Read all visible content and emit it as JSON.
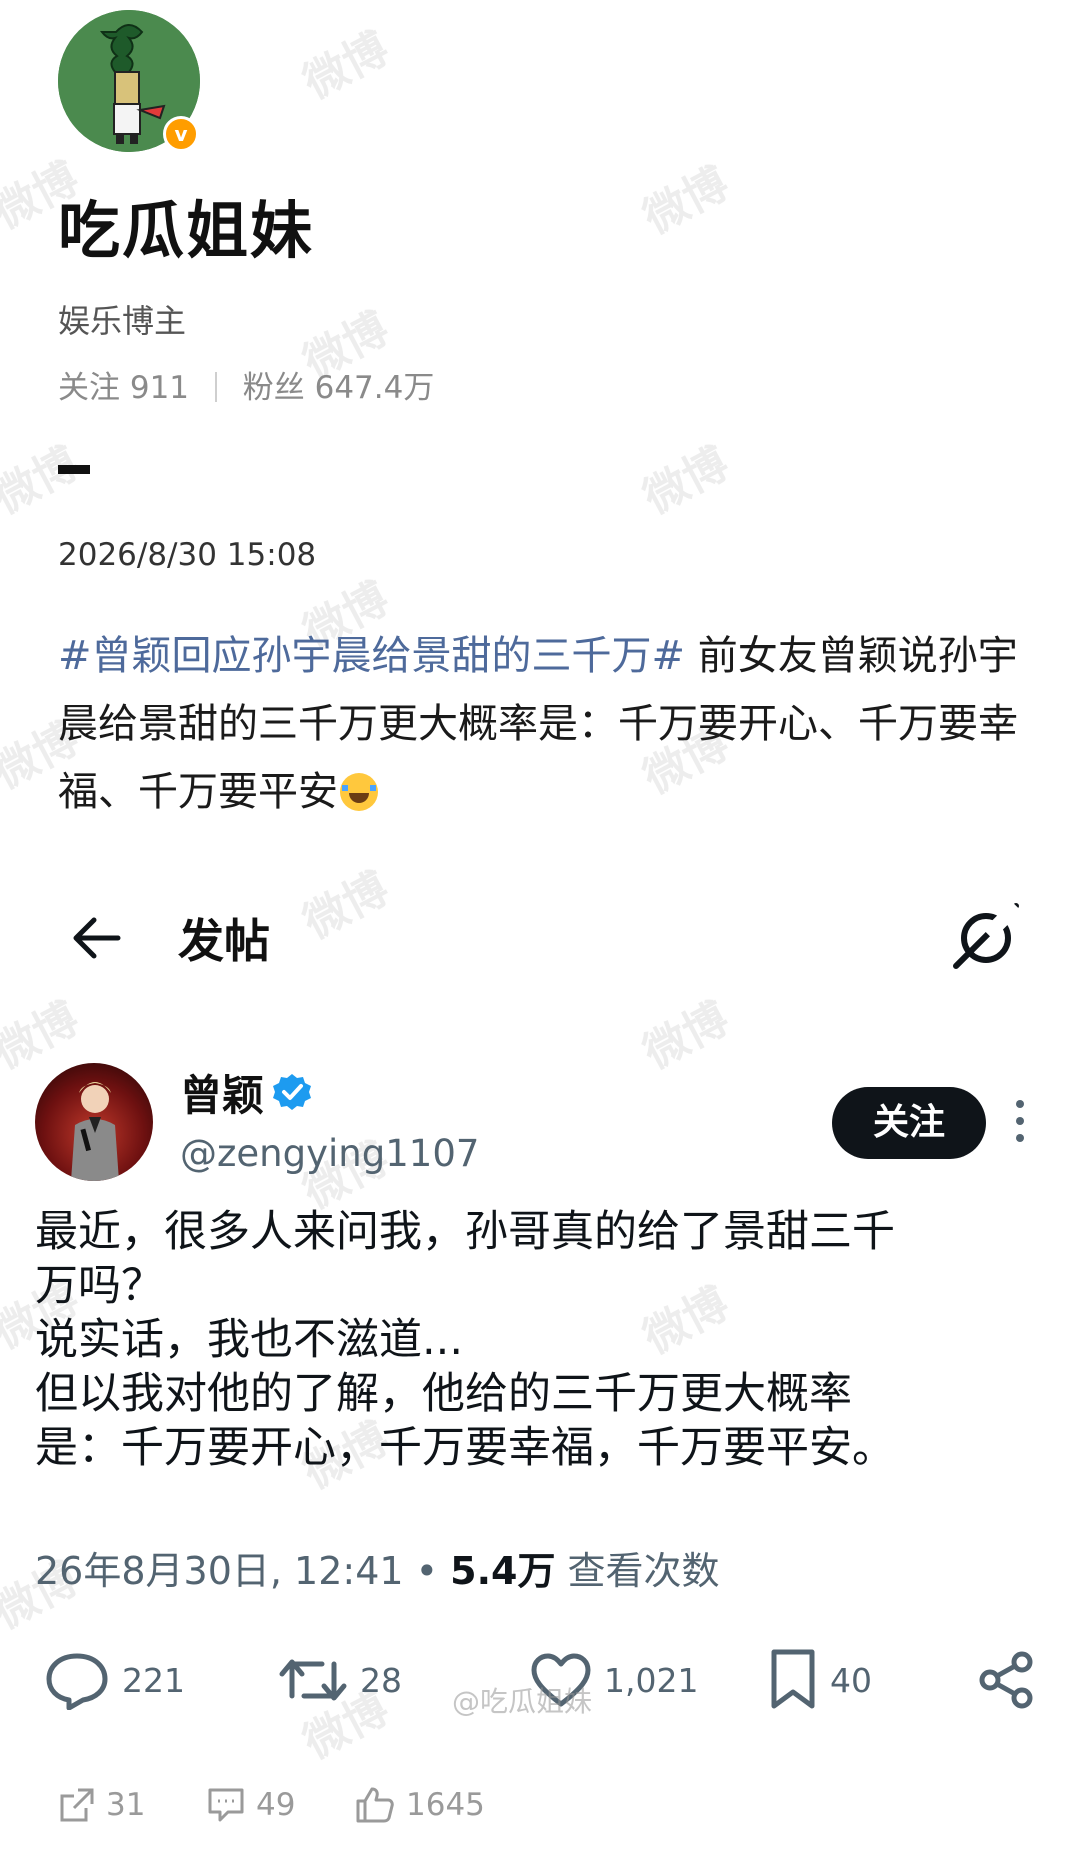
{
  "weibo": {
    "name": "吃瓜姐妹",
    "role": "娱乐博主",
    "follow_label": "关注",
    "follow_count": "911",
    "fans_label": "粉丝",
    "fans_count": "647.4万",
    "date": "2026/8/30 15:08",
    "hashtag": "#曾颖回应孙宇晨给景甜的三千万#",
    "body": " 前女友曾颖说孙宇晨给景甜的三千万更大概率是：千万要开心、千万要幸福、千万要平安",
    "verified_badge": "v",
    "watermark": "微博",
    "footer": {
      "share_count": "31",
      "comment_count": "49",
      "like_count": "1645"
    },
    "footer_watermark": "@吃瓜姐妹"
  },
  "x_post": {
    "header_title": "发帖",
    "author_name": "曾颖",
    "handle": "@zengying1107",
    "follow_button": "关注",
    "text": "最近，很多人来问我，孙哥真的给了景甜三千\n万吗？\n说实话，我也不滋道...\n但以我对他的了解，他给的三千万更大概率\n是：千万要开心，千万要幸福，千万要平安。",
    "time": "26年8月30日, 12:41 • ",
    "views": "5.4万",
    "views_label": " 查看次数",
    "replies": "221",
    "reposts": "28",
    "likes": "1,021",
    "bookmarks": "40",
    "accent_color": "#1d9bf0"
  }
}
